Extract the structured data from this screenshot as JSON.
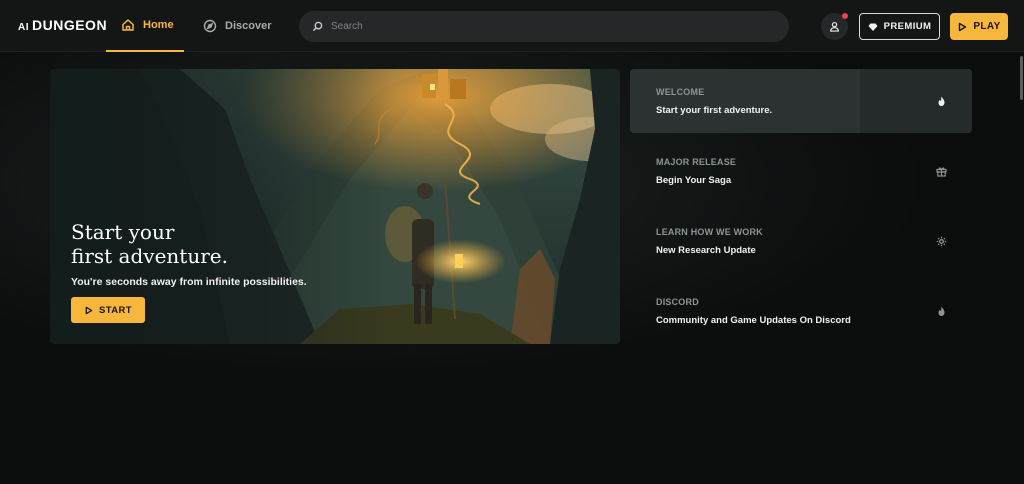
{
  "header": {
    "logo_prefix": "AI",
    "logo_name": "DUNGEON",
    "nav": [
      {
        "label": "Home",
        "icon": "home-icon",
        "active": true
      },
      {
        "label": "Discover",
        "icon": "compass-icon",
        "active": false
      }
    ],
    "search_placeholder": "Search",
    "premium_label": "PREMIUM",
    "play_label": "PLAY"
  },
  "hero": {
    "title_line1": "Start your",
    "title_line2": "first adventure.",
    "subtitle": "You're seconds away from infinite possibilities.",
    "start_label": "START"
  },
  "feed": [
    {
      "label": "WELCOME",
      "title": "Start your first adventure.",
      "icon": "flame-icon"
    },
    {
      "label": "MAJOR RELEASE",
      "title": "Begin Your Saga",
      "icon": "gift-icon"
    },
    {
      "label": "LEARN HOW WE WORK",
      "title": "New Research Update",
      "icon": "gear-icon"
    },
    {
      "label": "DISCORD",
      "title": "Community and Game Updates On Discord",
      "icon": "flame-icon"
    }
  ],
  "colors": {
    "accent": "#f6b73c",
    "background": "#0c0d0d",
    "topbar": "#141616",
    "notification": "#e8424a"
  }
}
